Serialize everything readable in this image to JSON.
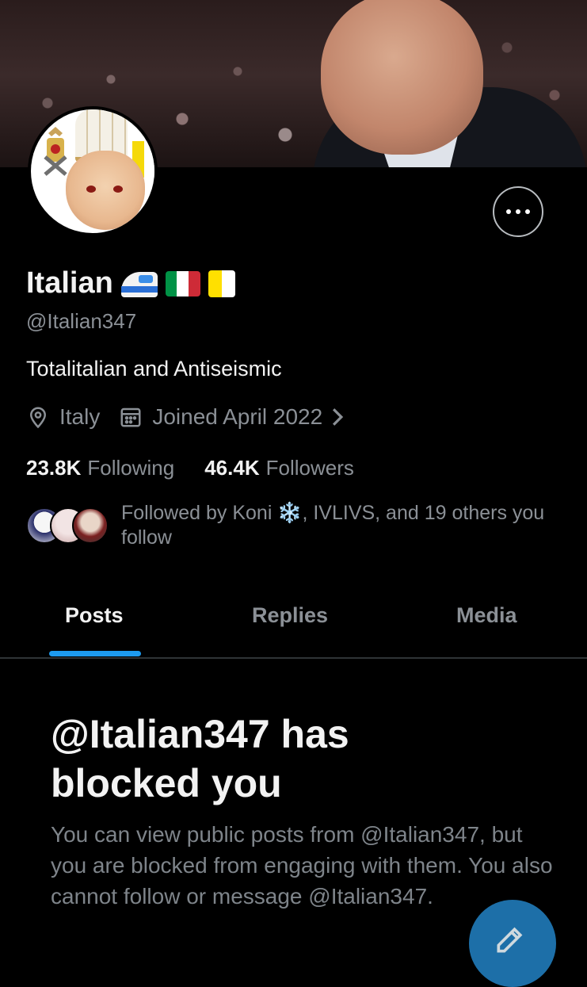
{
  "profile": {
    "name": "Italian",
    "handle": "@Italian347",
    "bio": "Totalitalian and Antiseismic",
    "location": "Italy",
    "joined": "Joined April 2022",
    "following_count": "23.8K",
    "following_label": "Following",
    "followers_count": "46.4K",
    "followers_label": "Followers",
    "followed_by_text": "Followed by Koni ❄️, IVLIVS, and 19 others you follow"
  },
  "name_emojis": [
    "train-emoji",
    "italy-flag-emoji",
    "vatican-flag-emoji"
  ],
  "tabs": [
    {
      "label": "Posts",
      "active": true
    },
    {
      "label": "Replies",
      "active": false
    },
    {
      "label": "Media",
      "active": false
    }
  ],
  "blocked": {
    "title": "@Italian347 has blocked you",
    "body": "You can view public posts from @Italian347, but you are blocked from engaging with them. You also cannot follow or message @Italian347."
  },
  "colors": {
    "background": "#000000",
    "accent": "#1d9bf0",
    "secondary_text": "#8b9096",
    "fab": "#1d6fa8"
  }
}
